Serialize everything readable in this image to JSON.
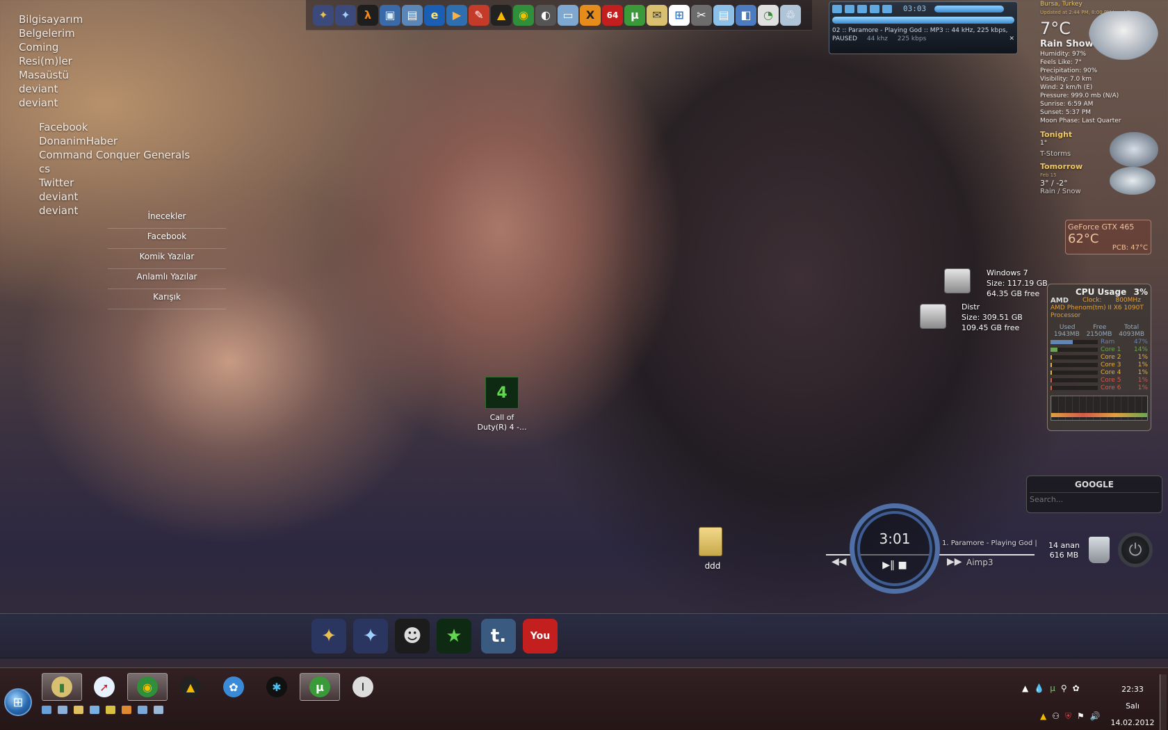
{
  "left_links": [
    "Bilgisayarım",
    "Belgelerim",
    "Coming",
    "Resi(m)ler",
    "Masaüstü",
    "deviant",
    "deviant"
  ],
  "left_links2": [
    "Facebook",
    "DonanimHaber",
    "Command Conquer Generals",
    "cs",
    "Twitter",
    "deviant",
    "deviant"
  ],
  "menu": [
    "İnecekler",
    "Facebook",
    "Komik Yazılar",
    "Anlamlı Yazılar",
    "Karışık"
  ],
  "player": {
    "time": "03:03",
    "track": "02 :: Paramore - Playing God :: MP3 :: 44 kHz, 225 kbps,",
    "status": "PAUSED",
    "khz": "44 khz",
    "kbps": "225 kbps"
  },
  "weather": {
    "location": "Bursa, Turkey",
    "updated": "Updated at 2:44 PM, 8:00 PM Local Time",
    "temp": "7°C",
    "condition": "Rain Shower",
    "details": [
      "Humidity: 97%",
      "Feels Like: 7°",
      "Precipitation: 90%",
      "Visibility: 7.0 km",
      "Wind: 2 km/h (E)",
      "Pressure: 999.0 mb (N/A)",
      "Sunrise: 6:59 AM",
      "Sunset: 5:37 PM",
      "Moon Phase: Last Quarter"
    ],
    "tonight_label": "Tonight",
    "tonight_temp": "1°",
    "tonight_cond": "T-Storms",
    "tomorrow_label": "Tomorrow",
    "tomorrow_date": "Feb 15",
    "tomorrow_temp": "3° / -2°",
    "tomorrow_cond": "Rain / Snow"
  },
  "gpu": {
    "name": "GeForce GTX 465",
    "temp": "62°C",
    "pcb": "PCB: 47°C"
  },
  "drives": [
    {
      "name": "Windows 7",
      "size": "Size: 117.19 GB",
      "free": "64.35 GB free"
    },
    {
      "name": "Distr",
      "size": "Size: 309.51 GB",
      "free": "109.45 GB free"
    }
  ],
  "cpu": {
    "title": "CPU Usage",
    "percent": "3%",
    "brand": "AMD",
    "clock_label": "Clock:",
    "clock": "800MHz",
    "model": "AMD Phenom(tm) II X6 1090T Processor",
    "headers": [
      "Used",
      "Free",
      "Total"
    ],
    "mem": [
      "1943MB",
      "2150MB",
      "4093MB"
    ],
    "rows": [
      {
        "label": "Ram",
        "val": "47%",
        "level": 0.47,
        "color": "#5f86b5"
      },
      {
        "label": "Core 1",
        "val": "14%",
        "level": 0.14,
        "color": "#6aa84f"
      },
      {
        "label": "Core 2",
        "val": "1%",
        "level": 0.01,
        "color": "#e6b040"
      },
      {
        "label": "Core 3",
        "val": "1%",
        "level": 0.01,
        "color": "#e6b040"
      },
      {
        "label": "Core 4",
        "val": "1%",
        "level": 0.01,
        "color": "#e6b040"
      },
      {
        "label": "Core 5",
        "val": "1%",
        "level": 0.01,
        "color": "#d65a4a"
      },
      {
        "label": "Core 6",
        "val": "1%",
        "level": 0.01,
        "color": "#d65a4a"
      }
    ]
  },
  "desktop_icons": {
    "cod": "Call of Duty(R) 4 -...",
    "cod_badge": "4",
    "folder": "ddd"
  },
  "google": {
    "title": "GOOGLE",
    "placeholder": "Search..."
  },
  "circle_player": {
    "time": "3:01",
    "track": "1. Paramore - Playing God |",
    "app": "Aimp3"
  },
  "recycle": {
    "items": "14 anan",
    "size": "616 MB"
  },
  "top_dock_icons": [
    {
      "name": "generals-zh-icon",
      "glyph": "✦",
      "bg": "#3b4a7a",
      "fg": "#e8c050"
    },
    {
      "name": "generals-icon",
      "glyph": "✦",
      "bg": "#3b4a7a",
      "fg": "#9fd0ff"
    },
    {
      "name": "half-life-icon",
      "glyph": "λ",
      "bg": "#1e1e1e",
      "fg": "#f08a1e"
    },
    {
      "name": "computer-icon",
      "glyph": "▣",
      "bg": "#3a6aa8",
      "fg": "#d8ecff"
    },
    {
      "name": "documents-icon",
      "glyph": "▤",
      "bg": "#5a86b8",
      "fg": "#ffffff"
    },
    {
      "name": "internet-explorer-icon",
      "glyph": "e",
      "bg": "#1a5fb4",
      "fg": "#ffe36e"
    },
    {
      "name": "media-player-icon",
      "glyph": "▶",
      "bg": "#2f6fb0",
      "fg": "#ffb040"
    },
    {
      "name": "paint-icon",
      "glyph": "✎",
      "bg": "#c43b2a",
      "fg": "#ffffff"
    },
    {
      "name": "aimp-icon",
      "glyph": "▲",
      "bg": "#222222",
      "fg": "#f5b800"
    },
    {
      "name": "chrome-icon",
      "glyph": "◉",
      "bg": "#2f8f3a",
      "fg": "#f2c200"
    },
    {
      "name": "photoscape-icon",
      "glyph": "◐",
      "bg": "#555555",
      "fg": "#ffffff"
    },
    {
      "name": "window-icon",
      "glyph": "▭",
      "bg": "#7fa8d0",
      "fg": "#ffffff"
    },
    {
      "name": "xfire-icon",
      "glyph": "X",
      "bg": "#e58c1a",
      "fg": "#202020"
    },
    {
      "name": "aida64-icon",
      "glyph": "64",
      "bg": "#c41f1f",
      "fg": "#ffffff"
    },
    {
      "name": "utorrent-icon",
      "glyph": "µ",
      "bg": "#3a9a3a",
      "fg": "#ffffff"
    },
    {
      "name": "mail-icon",
      "glyph": "✉",
      "bg": "#d8c070",
      "fg": "#3a3a3a"
    },
    {
      "name": "windows-flag-icon",
      "glyph": "⊞",
      "bg": "#ffffff",
      "fg": "#3a7cc8"
    },
    {
      "name": "tools-icon",
      "glyph": "✂",
      "bg": "#6c6c6c",
      "fg": "#ffffff"
    },
    {
      "name": "notepad-icon",
      "glyph": "▤",
      "bg": "#8cc0e8",
      "fg": "#ffffff"
    },
    {
      "name": "control-panel-icon",
      "glyph": "◧",
      "bg": "#4d7bc0",
      "fg": "#ffffff"
    },
    {
      "name": "chart-icon",
      "glyph": "◔",
      "bg": "#e0e0e0",
      "fg": "#3a8a3a"
    },
    {
      "name": "recycle-bin-icon",
      "glyph": "♲",
      "bg": "#b0c4d8",
      "fg": "#ffffff"
    }
  ],
  "bottom_dock_icons": [
    {
      "name": "generals-zh-icon",
      "glyph": "✦",
      "bg": "#2a3560",
      "fg": "#e8c050"
    },
    {
      "name": "generals-icon",
      "glyph": "✦",
      "bg": "#2a3560",
      "fg": "#9fd0ff"
    },
    {
      "name": "counter-strike-icon",
      "glyph": "☻",
      "bg": "#1c1c1c",
      "fg": "#dddddd"
    },
    {
      "name": "call-of-duty-icon",
      "glyph": "★",
      "bg": "#0f2a12",
      "fg": "#62d650"
    },
    {
      "name": "tumblr-icon",
      "glyph": "t.",
      "bg": "#3a5a80",
      "fg": "#ffffff"
    },
    {
      "name": "youtube-icon",
      "glyph": "You",
      "bg": "#c41f1f",
      "fg": "#ffffff"
    }
  ],
  "taskbar_apps": [
    {
      "name": "explorer-task",
      "glyph": "▮",
      "bg": "#d8c070",
      "fg": "#3a7a3a",
      "active": true
    },
    {
      "name": "safari-task",
      "glyph": "➚",
      "bg": "#e8f2ff",
      "fg": "#d22020",
      "active": false
    },
    {
      "name": "chrome-task",
      "glyph": "◉",
      "bg": "#2f8f3a",
      "fg": "#f2c200",
      "active": true
    },
    {
      "name": "aimp-task",
      "glyph": "▲",
      "bg": "#222222",
      "fg": "#f5b800",
      "active": false
    },
    {
      "name": "app-blue-task",
      "glyph": "✿",
      "bg": "#3a8ad8",
      "fg": "#ffffff",
      "active": false
    },
    {
      "name": "network-task",
      "glyph": "✱",
      "bg": "#111111",
      "fg": "#4ac0f0",
      "active": false
    },
    {
      "name": "utorrent-task",
      "glyph": "µ",
      "bg": "#3a9a3a",
      "fg": "#ffffff",
      "active": true
    },
    {
      "name": "steam-task",
      "glyph": "⏽",
      "bg": "#dddddd",
      "fg": "#333333",
      "active": false
    }
  ],
  "clock": {
    "time": "22:33",
    "day": "Salı",
    "date": "14.02.2012"
  }
}
